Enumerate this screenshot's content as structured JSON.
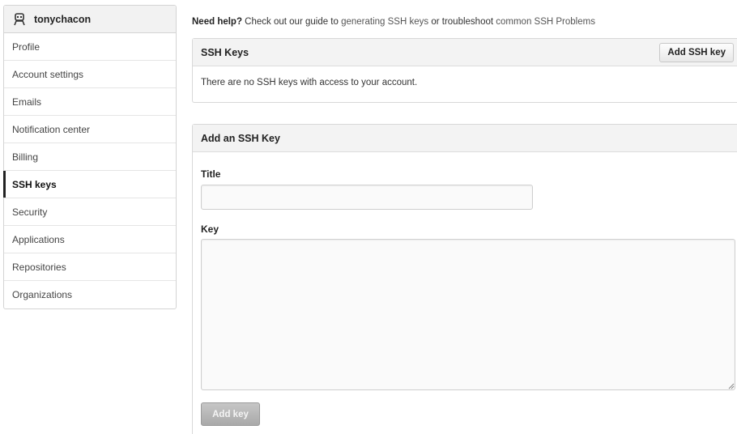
{
  "user": {
    "username": "tonychacon",
    "avatar_icon": "avatar-icon"
  },
  "sidebar": {
    "items": [
      {
        "label": "Profile"
      },
      {
        "label": "Account settings"
      },
      {
        "label": "Emails"
      },
      {
        "label": "Notification center"
      },
      {
        "label": "Billing"
      },
      {
        "label": "SSH keys",
        "active": true
      },
      {
        "label": "Security"
      },
      {
        "label": "Applications"
      },
      {
        "label": "Repositories"
      },
      {
        "label": "Organizations"
      }
    ]
  },
  "help": {
    "prefix": "Need help?",
    "text1": " Check out our guide to ",
    "link1": "generating SSH keys",
    "text2": " or troubleshoot ",
    "link2": "common SSH Problems"
  },
  "ssh_keys": {
    "title": "SSH Keys",
    "add_button": "Add SSH key",
    "empty_message": "There are no SSH keys with access to your account."
  },
  "add_key": {
    "title": "Add an SSH Key",
    "title_label": "Title",
    "title_value": "",
    "key_label": "Key",
    "key_value": "",
    "submit_label": "Add key"
  },
  "colors": {
    "active_indicator": "#222222",
    "disabled_button": "#b5b5b5"
  }
}
